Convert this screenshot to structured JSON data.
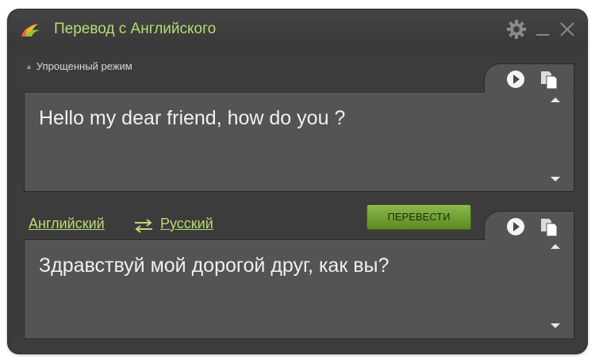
{
  "window": {
    "title": "Перевод с Английского",
    "colors": {
      "accent": "#b9dc74",
      "background": "#3c3c3c",
      "panel": "#545454",
      "button": "#6f9e32"
    }
  },
  "icons": [
    "logo-icon",
    "gear-icon",
    "minimize-icon",
    "close-icon",
    "play-icon",
    "copy-icon",
    "swap-arrows-icon",
    "scroll-up-icon",
    "scroll-down-icon"
  ],
  "mode_toggle": {
    "label": "Упрощенный режим"
  },
  "source": {
    "text": "Hello my dear friend, how do you ?"
  },
  "languages": {
    "from": "Английский",
    "to": "Русский"
  },
  "translate_button": {
    "label": "ПЕРЕВЕСТИ"
  },
  "result": {
    "text": "Здравствуй мой дорогой друг, как вы?"
  }
}
